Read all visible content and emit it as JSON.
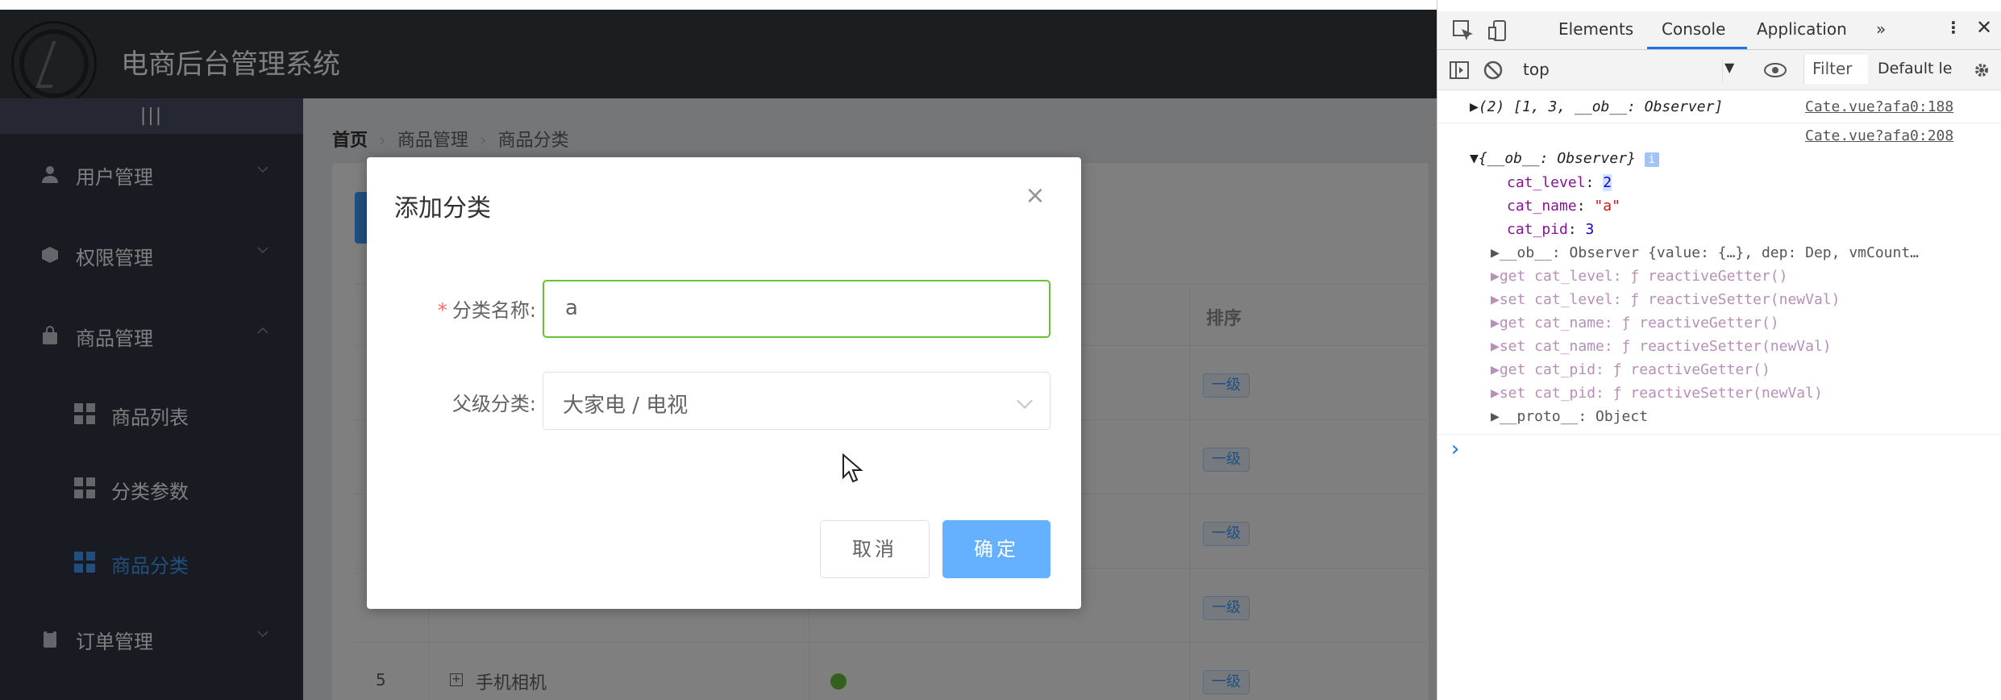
{
  "app": {
    "title": "电商后台管理系统",
    "toggle": "|||",
    "menu": [
      {
        "label": "用户管理",
        "icon": "user-icon"
      },
      {
        "label": "权限管理",
        "icon": "box-icon"
      },
      {
        "label": "商品管理",
        "icon": "bag-icon"
      },
      {
        "label": "订单管理",
        "icon": "clipboard-icon"
      }
    ],
    "submenu": [
      {
        "label": "商品列表"
      },
      {
        "label": "分类参数"
      },
      {
        "label": "商品分类"
      }
    ],
    "breadcrumb": {
      "home": "首页",
      "level1": "商品管理",
      "level2": "商品分类",
      "sep": "›"
    },
    "table": {
      "header_sort": "排序",
      "tag_label": "一级",
      "last_row": {
        "index": "5",
        "name": "手机相机"
      }
    },
    "accent": "#409eff"
  },
  "dialog": {
    "title": "添加分类",
    "close": "×",
    "name_label": "分类名称:",
    "required_mark": "*",
    "name_value": "a",
    "parent_label": "父级分类:",
    "parent_value": "大家电 / 电视",
    "cancel": "取消",
    "confirm": "确定"
  },
  "devtools": {
    "tabs": {
      "elements": "Elements",
      "console": "Console",
      "application": "Application",
      "more": "»"
    },
    "toolbar": {
      "context": "top",
      "filter": "Filter",
      "levels": "Default le"
    },
    "console": {
      "line1": "▶(2) [1, 3, __ob__: Observer]",
      "line1_src": "Cate.vue?afa0:188",
      "line2_src": "Cate.vue?afa0:208",
      "obj_head": "▼{__ob__: Observer}",
      "info_badge": "i",
      "cat_level_key": "cat_level",
      "cat_level_val": "2",
      "cat_name_key": "cat_name",
      "cat_name_val": "\"a\"",
      "cat_pid_key": "cat_pid",
      "cat_pid_val": "3",
      "ob_line": "▶__ob__: Observer {value: {…}, dep: Dep, vmCount…",
      "get_level": "▶get cat_level: ƒ reactiveGetter()",
      "set_level": "▶set cat_level: ƒ reactiveSetter(newVal)",
      "get_name": "▶get cat_name: ƒ reactiveGetter()",
      "set_name": "▶set cat_name: ƒ reactiveSetter(newVal)",
      "get_pid": "▶get cat_pid: ƒ reactiveGetter()",
      "set_pid": "▶set cat_pid: ƒ reactiveSetter(newVal)",
      "proto": "▶__proto__: Object",
      "prompt": "›"
    }
  }
}
